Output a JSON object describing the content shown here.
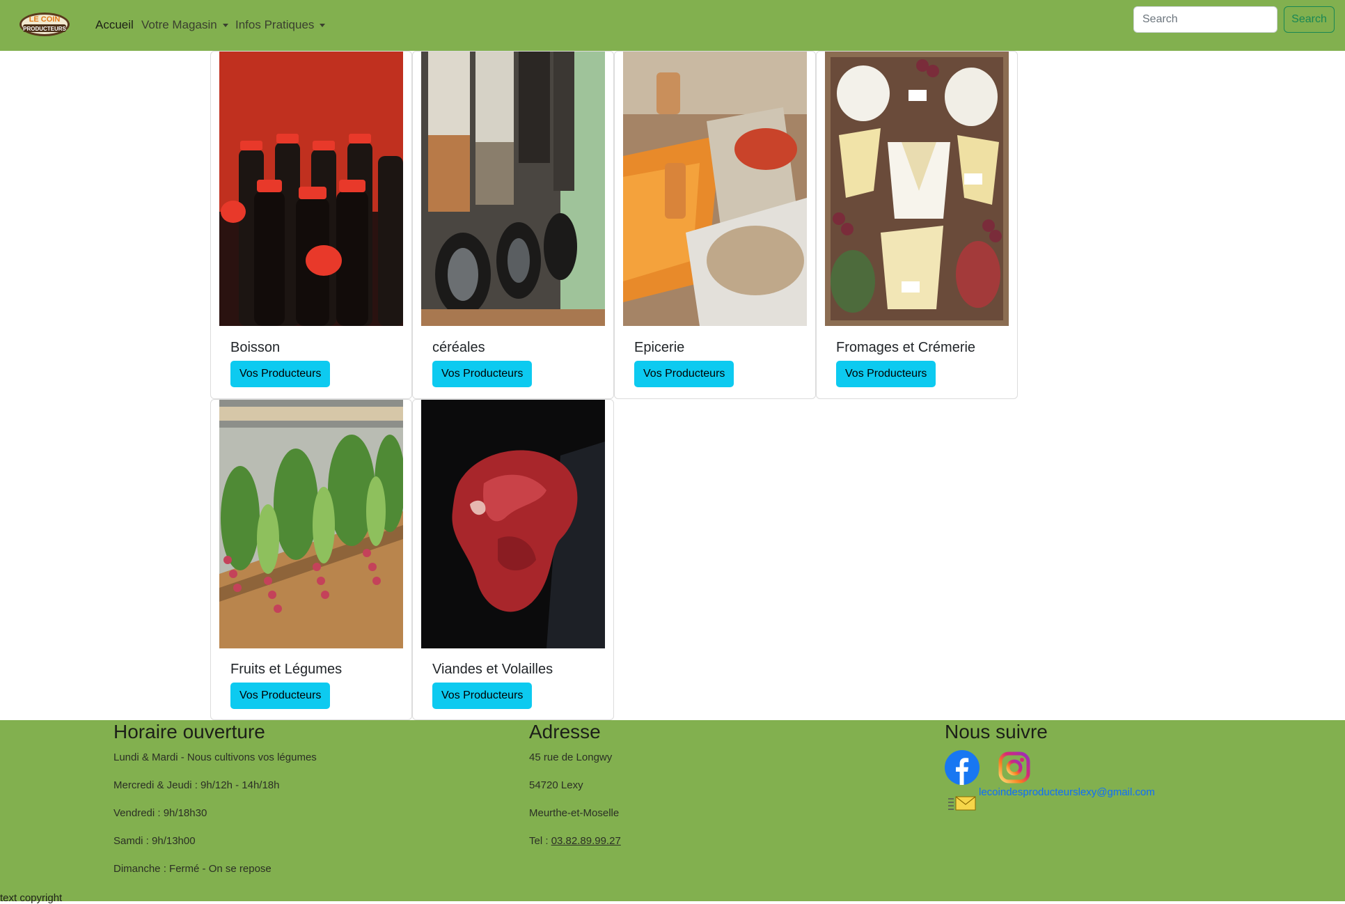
{
  "brand": {
    "logo_text": "LE COIN DES PRODUCTEURS"
  },
  "nav": {
    "items": [
      {
        "label": "Accueil",
        "active": true,
        "dropdown": false
      },
      {
        "label": "Votre Magasin",
        "active": false,
        "dropdown": true
      },
      {
        "label": "Infos Pratiques",
        "active": false,
        "dropdown": true
      }
    ],
    "search": {
      "placeholder": "Search",
      "button_label": "Search"
    }
  },
  "categories": [
    {
      "name": "Boisson",
      "button_label": "Vos Producteurs",
      "image": "bottles-photo"
    },
    {
      "name": "céréales",
      "button_label": "Vos Producteurs",
      "image": "cereal-dispensers-photo"
    },
    {
      "name": "Epicerie",
      "button_label": "Vos Producteurs",
      "image": "spices-photo"
    },
    {
      "name": "Fromages et Crémerie",
      "button_label": "Vos Producteurs",
      "image": "cheese-platter-photo"
    },
    {
      "name": "Fruits et Légumes",
      "button_label": "Vos Producteurs",
      "image": "vegetables-photo"
    },
    {
      "name": "Viandes et Volailles",
      "button_label": "Vos Producteurs",
      "image": "meat-photo"
    }
  ],
  "footer": {
    "hours": {
      "title": "Horaire ouverture",
      "lines": [
        "Lundi & Mardi - Nous cultivons vos légumes",
        "Mercredi & Jeudi : 9h/12h - 14h/18h",
        "Vendredi : 9h/18h30",
        "Samdi : 9h/13h00",
        "Dimanche : Fermé - On se repose"
      ]
    },
    "address": {
      "title": "Adresse",
      "lines": [
        "45 rue de Longwy",
        "54720 Lexy",
        "Meurthe-et-Moselle"
      ],
      "tel_label": "Tel : ",
      "tel_number": "03.82.89.99.27"
    },
    "social": {
      "title": "Nous suivre",
      "email": "lecoindesproducteurslexy@gmail.com"
    },
    "copyright": "text copyright"
  },
  "colors": {
    "brand_green": "#82b04f",
    "info_button": "#0dcaf0",
    "search_outline": "#198754"
  }
}
